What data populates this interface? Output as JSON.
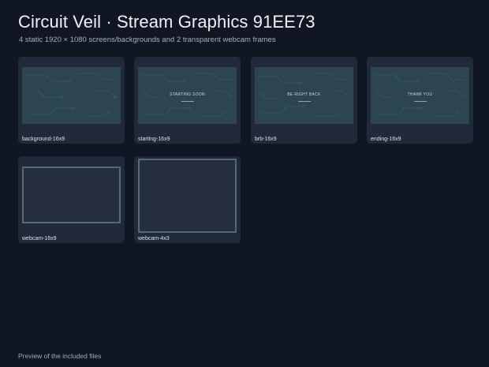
{
  "header": {
    "title": "Circuit Veil · Stream Graphics 91EE73",
    "subtitle": "4 static 1920 × 1080 screens/backgrounds and 2 transparent webcam frames"
  },
  "files": [
    {
      "label": "background-16x9",
      "overlay_text": ""
    },
    {
      "label": "starting-16x9",
      "overlay_text": "STARTING SOON"
    },
    {
      "label": "brb-16x9",
      "overlay_text": "BE RIGHT BACK"
    },
    {
      "label": "ending-16x9",
      "overlay_text": "THANK YOU"
    },
    {
      "label": "webcam-16x9"
    },
    {
      "label": "webcam-4x3"
    }
  ],
  "footer": {
    "caption": "Preview of the included files"
  },
  "colors": {
    "background": "#111722",
    "card": "#212a3a",
    "screen_fill": "#2c4650",
    "webcam_frame": "#566a76"
  }
}
